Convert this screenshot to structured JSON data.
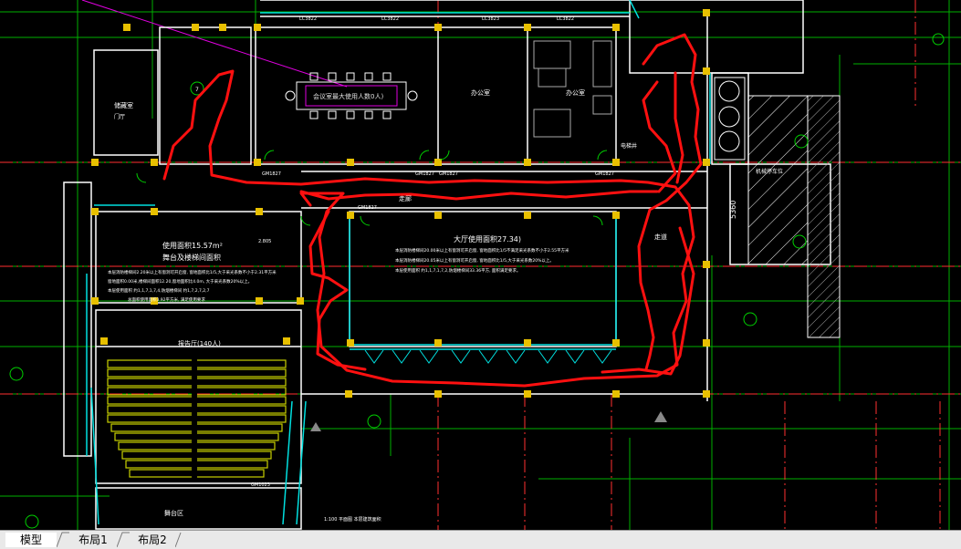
{
  "rooms": {
    "meeting_label": "会议室最大使用人数0人)",
    "office1": "办公室",
    "office2": "办公室",
    "storage": "储藏室",
    "hall_area": "大厅使用面积27.34)",
    "hall_note1": "本层消防楼梯间20.00米以上有窗洞可开启窗, 窗地面积比1/5不满足采光系数不小于2.55平方米",
    "hall_note2": "本层消防楼梯间20.05米以上有窗洞可开启窗, 窗地面积比1/5,大于采光系数20%以上。",
    "hall_note3": "本层使用面积 约1,1,7,1,7,2,防烟楼梯间33.36平方, 面积满足要求。",
    "left_area1": "使用面积15.57m²",
    "left_area2": "舞台及楼梯间面积",
    "left_note1": "本层消防楼梯间2.20米以上有窗洞可开启窗, 窗地面积比1/5,大于采光系数不小于2.31平方米",
    "left_note2": "窗地面积0.00米,楼梯间面积12.20,窗地面积比4.0m, 大于采光系数20%以上。",
    "left_note3": "本层使用面积 约1,1,7,1,7,4,防烟楼梯间 约1,7,2,7,2,7",
    "left_note4": "总面积使用面积3.92平方米, 满足使用要求",
    "auditorium": "报告厅(140人)",
    "corridor": "走廊",
    "corridor2": "走道",
    "stage_label": "舞台区",
    "lobby": "门厅",
    "right_label": "机械停车位",
    "elevator": "电梯井",
    "bottom_note": "1:100 平面图 本层建筑面积",
    "door_gm1": "GM1827",
    "door_gm2": "GM1827",
    "door_gm3": "GM1827",
    "door_gm4": "GM1827",
    "door_gm5": "GM1827",
    "door_gm6": "GM1023",
    "dim_5360": "5360",
    "win_1": "LC3822",
    "win_2": "LC3822",
    "win_3": "LC3823",
    "win_4": "LC3822",
    "lbl_2805": "2.805",
    "axis_7": "7"
  },
  "tabs": [
    {
      "label": "模型",
      "active": true
    },
    {
      "label": "布局1",
      "active": false
    },
    {
      "label": "布局2",
      "active": false
    }
  ],
  "colors": {
    "background": "#000000",
    "wall": "#ffffff",
    "column": "#e8c000",
    "grid": "#00c000",
    "red_axis": "#ff3030",
    "cyan": "#00e0e0",
    "magenta": "#e000e0",
    "markup": "#ff0000"
  }
}
